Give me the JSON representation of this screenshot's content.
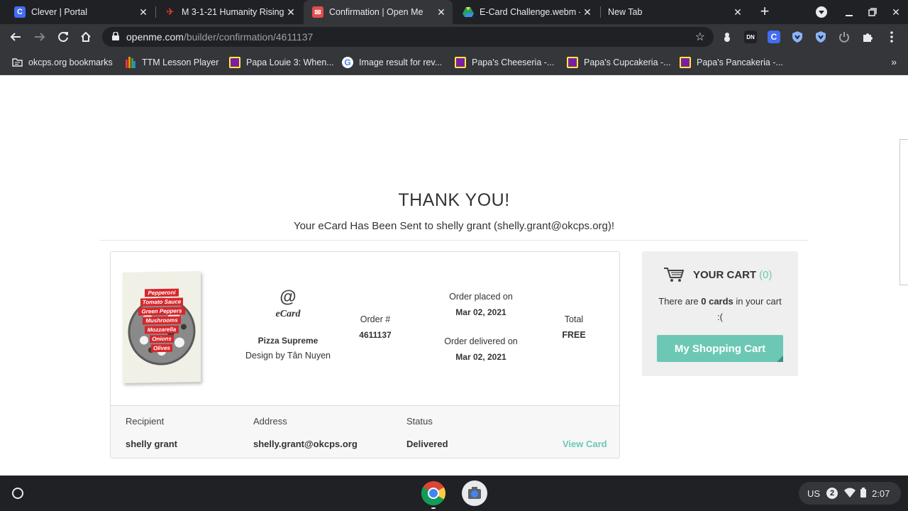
{
  "browser": {
    "tabs": [
      {
        "title": "Clever | Portal",
        "icon": "clever-icon",
        "icon_color": "#436cf2",
        "active": false
      },
      {
        "title": "M 3-1-21 Humanity Rising",
        "icon": "humanity-rising-icon",
        "icon_color": "#c63b2b",
        "active": false
      },
      {
        "title": "Confirmation | Open Me",
        "icon": "openme-icon",
        "icon_color": "#e44d4d",
        "active": true
      },
      {
        "title": "E-Card Challenge.webm - G",
        "icon": "google-drive-icon",
        "icon_color": "#1fa463",
        "active": false
      },
      {
        "title": "New Tab",
        "icon": "none",
        "icon_color": "",
        "active": false
      }
    ],
    "new_tab_symbol": "+",
    "url_host": "openme.com",
    "url_path": "/builder/confirmation/4611137",
    "bookmarks": [
      {
        "label": "okcps.org bookmarks",
        "icon": "folder-icon"
      },
      {
        "label": "TTM Lesson Player",
        "icon": "ttm-icon"
      },
      {
        "label": "Papa Louie 3: When...",
        "icon": "papa-louie-icon"
      },
      {
        "label": "Image result for rev...",
        "icon": "google-icon"
      },
      {
        "label": "Papa's Cheeseria -...",
        "icon": "papa-cheeseria-icon"
      },
      {
        "label": "Papa's Cupcakeria -...",
        "icon": "papa-cupcakeria-icon"
      },
      {
        "label": "Papa's Pancakeria -...",
        "icon": "papa-pancakeria-icon"
      }
    ],
    "bookmarks_overflow": "»"
  },
  "page": {
    "heading": "THANK YOU!",
    "sent_message": "Your eCard Has Been Sent to shelly grant (shelly.grant@okcps.org)!",
    "order": {
      "card_lines": [
        "Pepperoni",
        "Tomato Sauce",
        "Green Peppers",
        "Mushrooms",
        "Mozzarella",
        "Onions",
        "Olives"
      ],
      "ecard_symbol": "@",
      "ecard_word": "eCard",
      "card_name": "Pizza Supreme",
      "designer": "Design by Tân Nuyen",
      "order_number_label": "Order #",
      "order_number": "4611137",
      "placed_label": "Order placed on",
      "placed_date": "Mar 02, 2021",
      "delivered_label": "Order delivered on",
      "delivered_date": "Mar 02, 2021",
      "total_label": "Total",
      "total_value": "FREE",
      "recipient_label": "Recipient",
      "recipient": "shelly grant",
      "address_label": "Address",
      "address": "shelly.grant@okcps.org",
      "status_label": "Status",
      "status": "Delivered",
      "view_card": "View Card"
    },
    "cart": {
      "title": "YOUR CART",
      "count": "(0)",
      "msg_pre": "There are ",
      "msg_count": "0 cards",
      "msg_post": " in your cart",
      "msg_face": ":(",
      "button": "My Shopping Cart"
    },
    "accent_color": "#6cc8b5"
  },
  "shelf": {
    "ime": "US",
    "notifications": "2",
    "time": "2:07"
  }
}
